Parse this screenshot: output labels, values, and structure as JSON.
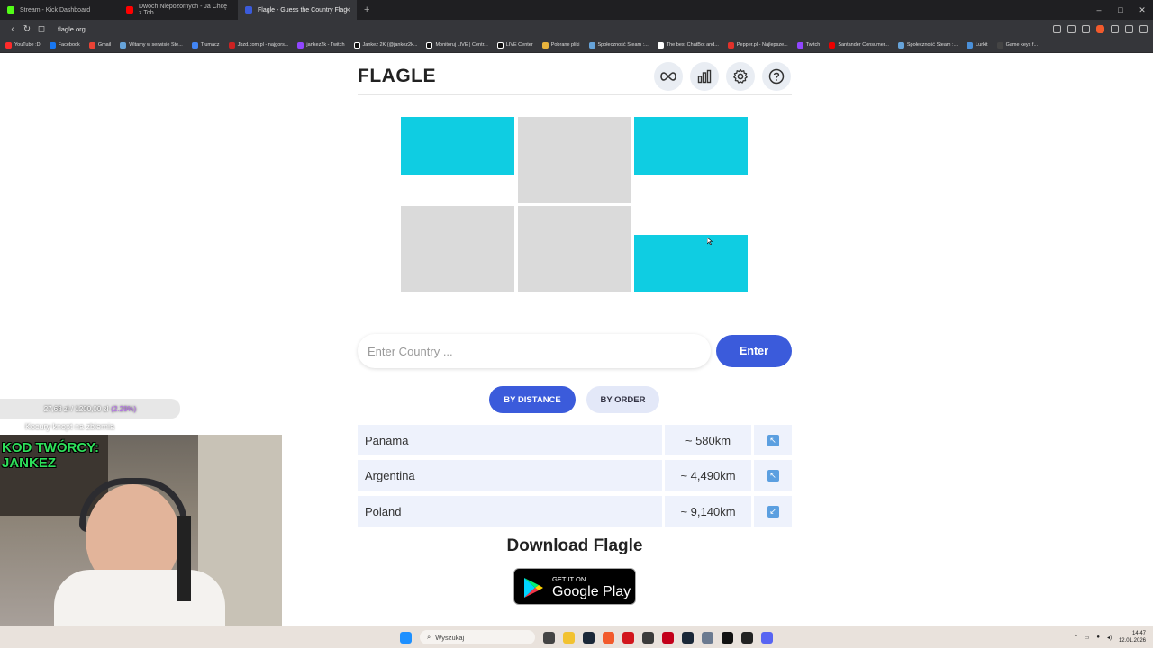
{
  "browser": {
    "tabs": [
      {
        "label": "Stream - Kick Dashboard",
        "color": "#53fc18"
      },
      {
        "label": "Dwóch Niepozornych - Ja Chcę z Tob",
        "color": "#ff0000"
      },
      {
        "label": "Flagle - Guess the Country Flag",
        "color": "#3b5bdb"
      }
    ],
    "url": "flagle.org",
    "bookmarks": [
      "YouTube :D",
      "Facebook",
      "Gmail",
      "Witamy w serwisie Ste...",
      "Tłumacz",
      "Jbzd.com.pl - najgors...",
      "jankez2k - Twitch",
      "Jankez 2K (@jankez2k...",
      "Monitoruj LIVE | Centr...",
      "LIVE Center",
      "Pobrane pliki",
      "Społeczność Steam :...",
      "The best ChatBot and...",
      "Pepper.pl - Najlepsze...",
      "Twitch",
      "Santander Consumer...",
      "Społeczność Steam :...",
      "Lurkit",
      "Game keys f..."
    ]
  },
  "app": {
    "title": "FLAGLE",
    "icons": [
      "infinity-icon",
      "stats-icon",
      "gear-icon",
      "help-icon"
    ],
    "colors": {
      "cyan": "#0fcde2",
      "hidden": "#dadada",
      "accent": "#3b5bdb",
      "row": "#eef2fc"
    }
  },
  "input": {
    "placeholder": "Enter Country ...",
    "value": "",
    "button": "Enter"
  },
  "sort": {
    "active": "BY DISTANCE",
    "inactive": "BY ORDER"
  },
  "guesses": [
    {
      "country": "Panama",
      "distance": "~ 580km",
      "direction": "↖"
    },
    {
      "country": "Argentina",
      "distance": "~ 4,490km",
      "direction": "↖"
    },
    {
      "country": "Poland",
      "distance": "~ 9,140km",
      "direction": "↙"
    }
  ],
  "download": {
    "title": "Download Flagle",
    "store_small": "GET IT ON",
    "store_big": "Google Play"
  },
  "stream": {
    "donation": "27,68 zł / 1200,00 zł",
    "percent": "(2.29%)",
    "donation_sub": "Kocury knopt na zbiernia",
    "code": "KOD TWÓRCY: JANKEZ"
  },
  "taskbar": {
    "search": "Wyszukaj",
    "time": "14:47",
    "date": "12.01.2026"
  }
}
